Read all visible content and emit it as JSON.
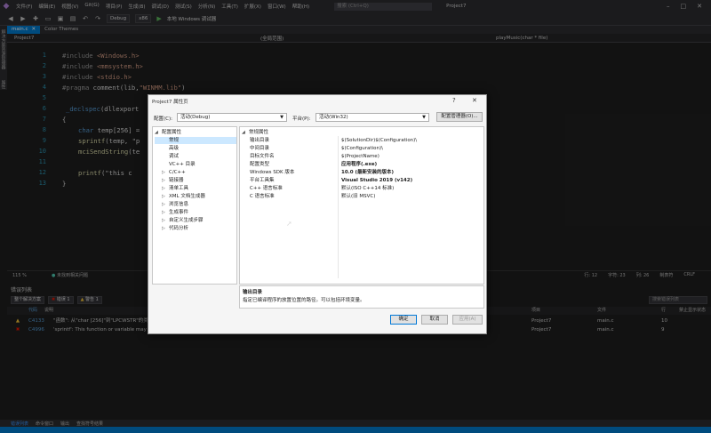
{
  "menubar": {
    "items": [
      "文件(F)",
      "编辑(E)",
      "视图(V)",
      "Git(G)",
      "项目(P)",
      "生成(B)",
      "调试(D)",
      "测试(S)",
      "分析(N)",
      "工具(T)",
      "扩展(X)",
      "窗口(W)",
      "帮助(H)"
    ],
    "search_placeholder": "搜索 (Ctrl+Q)",
    "project": "Project7"
  },
  "toolbar": {
    "config": "Debug",
    "platform": "x86",
    "run_label": "本地 Windows 调试器"
  },
  "left_strip": [
    "解决方案资源管理器",
    "属性"
  ],
  "doc_tabs": [
    {
      "label": "main.c",
      "active": true
    },
    {
      "label": "Color Themes",
      "active": false
    }
  ],
  "navbar": {
    "project": "Project7",
    "scope": "(全局范围)",
    "member": "playMusic(char * file)"
  },
  "editor": {
    "line_numbers": [
      "1",
      "2",
      "3",
      "4",
      "5",
      "6",
      "7",
      "8",
      "9",
      "10",
      "11",
      "12",
      "13"
    ],
    "l2_kw": "#include",
    "l2_arg": "<Windows.h>",
    "l3_kw": "#include",
    "l3_arg": "<mmsystem.h>",
    "l4_kw": "#include",
    "l4_arg": "<stdio.h>",
    "l5_kw": "#pragma",
    "l5_rest": "comment(lib,",
    "l5_str": "\"WINMM.lib\"",
    "l5_end": ")",
    "l7_kw": "_declspec",
    "l7_rest": "(dllexport",
    "l8": "{",
    "l9_kw": "char",
    "l9_rest": "temp[256] =",
    "l10_fn": "sprintf",
    "l10_rest": "(temp, \"p",
    "l11_fn": "mciSendString",
    "l11_rest": "(te",
    "l13_fn": "printf",
    "l13_rest": "(\"this c",
    "l14": "}"
  },
  "editor_status": {
    "zoom": "115 %",
    "ok_text": "未找到相关问题",
    "line": "行: 12",
    "char": "字符: 23",
    "col": "列: 26",
    "tab": "制表符",
    "crlf": "CRLF"
  },
  "error_list": {
    "title": "错误列表",
    "scope_filter": "整个解决方案",
    "errors_btn": "错误 1",
    "warnings_btn": "警告 1",
    "search_placeholder": "搜索错误列表",
    "headers": {
      "code": "代码",
      "desc": "说明",
      "project": "项目",
      "file": "文件",
      "line": "行",
      "suppress": "禁止显示状态"
    },
    "rows": [
      {
        "type": "warning",
        "code": "C4133",
        "desc": "\"函数\": 从\"char [256]\"到\"LPCWSTR\"的类型不兼容",
        "project": "Project7",
        "file": "main.c",
        "line": "10"
      },
      {
        "type": "error",
        "code": "C4996",
        "desc": "'sprintf': This function or variable may be unsafe. Consider using sprintf_s instead. To disable deprecation, use _CRT_SECURE_NO_WARNINGS. See online help for details.",
        "project": "Project7",
        "file": "main.c",
        "line": "9"
      }
    ]
  },
  "bottom_tabs": [
    "错误列表",
    "命令窗口",
    "输出",
    "查找符号结果"
  ],
  "dialog": {
    "title": "Project7 属性页",
    "help": "?",
    "close": "✕",
    "config_label": "配置(C):",
    "config_value": "活动(Debug)",
    "platform_label": "平台(P):",
    "platform_value": "活动(Win32)",
    "config_manager": "配置管理器(O)...",
    "tree": [
      {
        "label": "配置属性",
        "level": 0,
        "expander": "◢"
      },
      {
        "label": "常规",
        "level": 1,
        "selected": true
      },
      {
        "label": "高级",
        "level": 1
      },
      {
        "label": "调试",
        "level": 1
      },
      {
        "label": "VC++ 目录",
        "level": 1
      },
      {
        "label": "C/C++",
        "level": 1,
        "expander": "▷"
      },
      {
        "label": "链接器",
        "level": 1,
        "expander": "▷"
      },
      {
        "label": "清单工具",
        "level": 1,
        "expander": "▷"
      },
      {
        "label": "XML 文档生成器",
        "level": 1,
        "expander": "▷"
      },
      {
        "label": "浏览信息",
        "level": 1,
        "expander": "▷"
      },
      {
        "label": "生成事件",
        "level": 1,
        "expander": "▷"
      },
      {
        "label": "自定义生成步骤",
        "level": 1,
        "expander": "▷"
      },
      {
        "label": "代码分析",
        "level": 1,
        "expander": "▷"
      }
    ],
    "group": "常规属性",
    "properties": [
      {
        "name": "输出目录",
        "value": "$(SolutionDir)$(Configuration)\\",
        "bold": false
      },
      {
        "name": "中间目录",
        "value": "$(Configuration)\\",
        "bold": false
      },
      {
        "name": "目标文件名",
        "value": "$(ProjectName)",
        "bold": false
      },
      {
        "name": "配置类型",
        "value": "应用程序(.exe)",
        "bold": true
      },
      {
        "name": "Windows SDK 版本",
        "value": "10.0 (最新安装的版本)",
        "bold": true
      },
      {
        "name": "平台工具集",
        "value": "Visual Studio 2019 (v142)",
        "bold": true
      },
      {
        "name": "C++ 语言标准",
        "value": "默认(ISO C++14 标准)",
        "bold": false
      },
      {
        "name": "C 语言标准",
        "value": "默认(旧 MSVC)",
        "bold": false
      }
    ],
    "desc_title": "输出目录",
    "desc_body": "指定已编译程序的放置位置的路径。可以包括环境变量。",
    "ok": "确定",
    "cancel": "取消",
    "apply": "应用(A)"
  },
  "colors": {
    "accent": "#007acc",
    "warning": "#f0c036",
    "error": "#e51400"
  }
}
